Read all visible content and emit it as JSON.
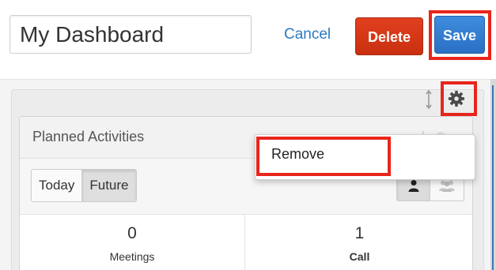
{
  "header": {
    "dashboard_name_value": "My Dashboard",
    "cancel_label": "Cancel",
    "delete_label": "Delete",
    "save_label": "Save"
  },
  "dashlet": {
    "title": "Planned Activities",
    "filters": [
      {
        "label": "Today",
        "selected": false
      },
      {
        "label": "Future",
        "selected": true
      }
    ],
    "stats": [
      {
        "count": "0",
        "label": "Meetings"
      },
      {
        "count": "1",
        "label": "Call"
      }
    ]
  },
  "menu": {
    "remove_label": "Remove"
  },
  "colors": {
    "delete_red": "#d43a17",
    "save_blue": "#3a84d6",
    "highlight_red": "#e8251b",
    "link_blue": "#2a79c2"
  },
  "icons": {
    "resize": "resize-icon",
    "gear": "gear-icon",
    "single_user": "user-icon",
    "group": "group-icon"
  }
}
